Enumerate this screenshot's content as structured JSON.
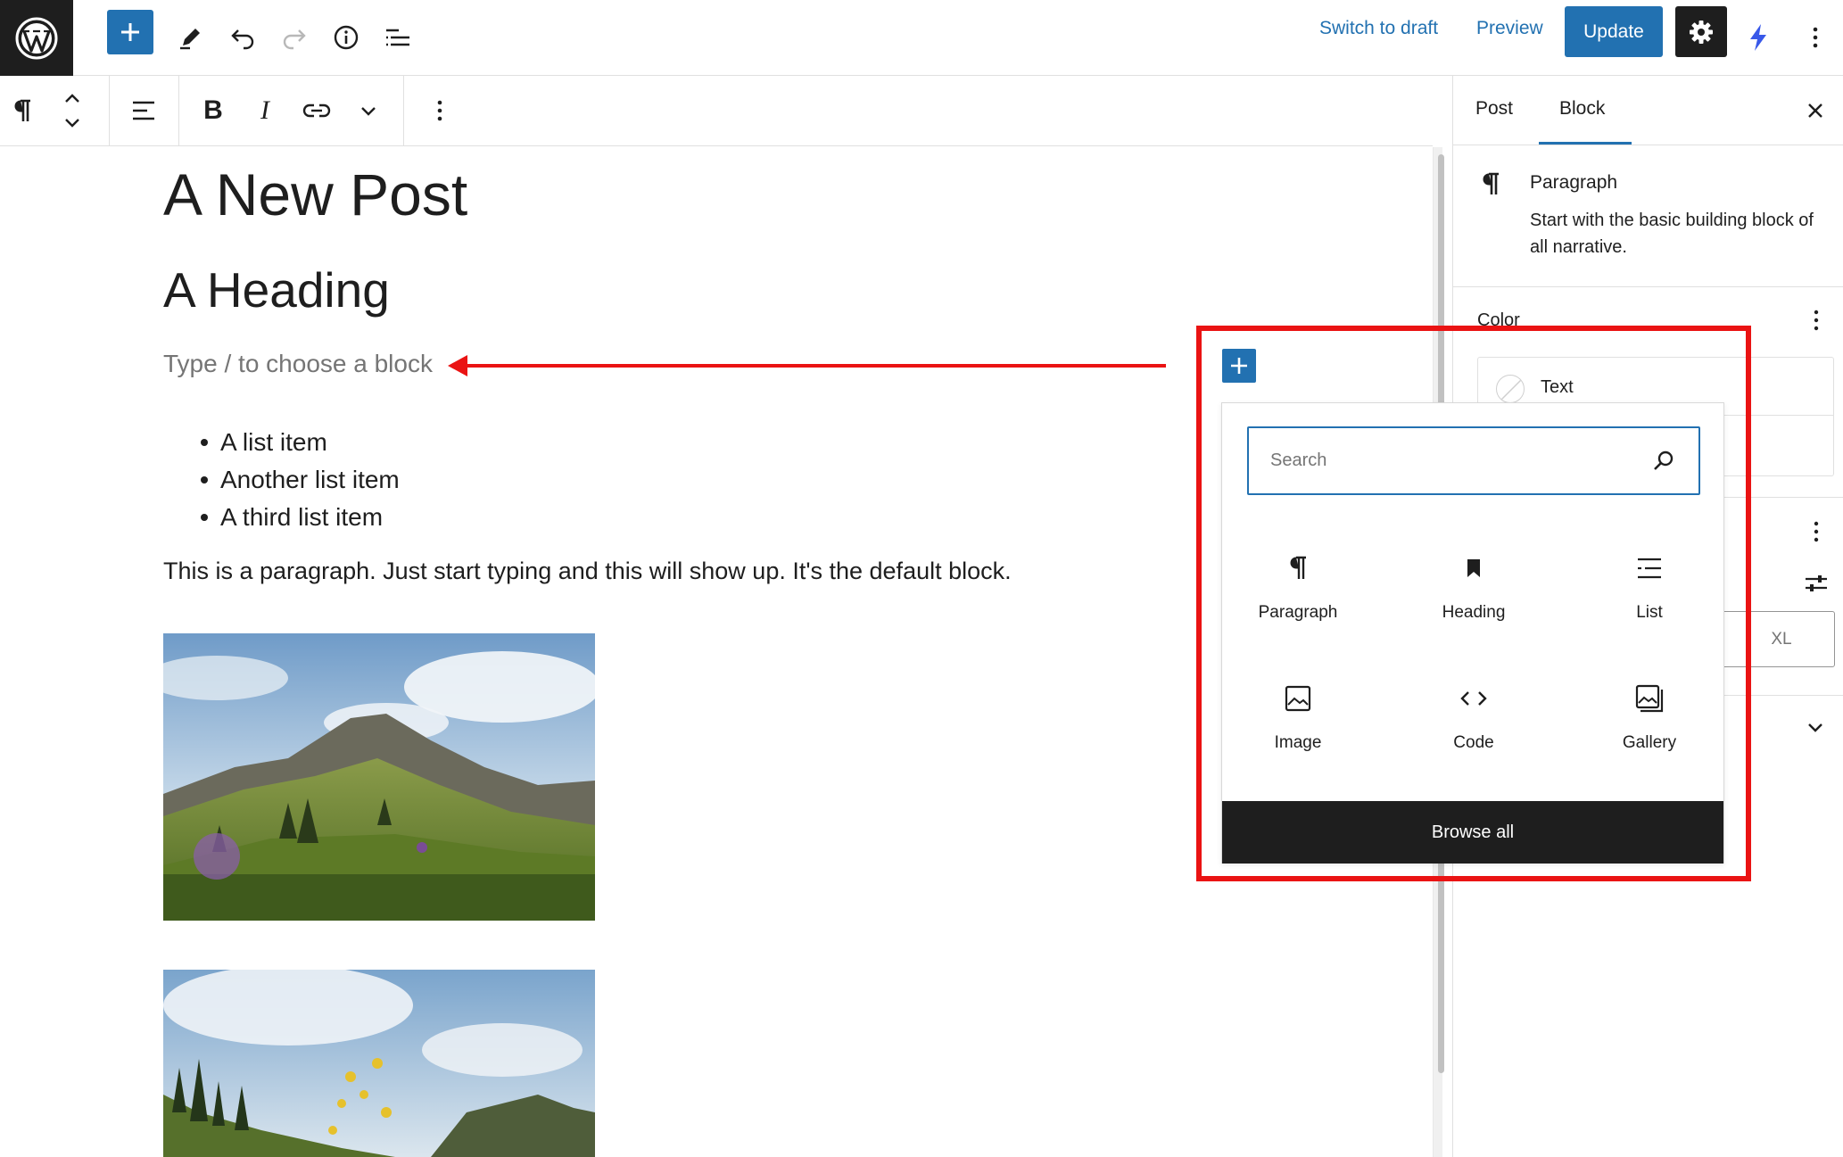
{
  "topbar": {
    "switch_to_draft": "Switch to draft",
    "preview": "Preview",
    "update": "Update",
    "icons": [
      "wordpress-logo",
      "plus-icon",
      "pencil-icon",
      "undo-icon",
      "redo-icon",
      "info-icon",
      "list-view-icon",
      "gear-icon",
      "lightning-icon",
      "more-vertical-icon"
    ]
  },
  "block_toolbar": {
    "icons": [
      "paragraph-icon",
      "move-up-down-icon",
      "align-icon",
      "bold-icon",
      "italic-icon",
      "link-icon",
      "chevron-down-icon",
      "more-vertical-icon"
    ],
    "bold": "B",
    "italic": "I"
  },
  "editor": {
    "post_title": "A New Post",
    "heading": "A Heading",
    "placeholder": "Type / to choose a block",
    "list_items": [
      "A list item",
      "Another list item",
      "A third list item"
    ],
    "paragraph": "This is a paragraph. Just start typing and this will show up. It's the default block."
  },
  "sidebar": {
    "tabs": [
      "Post",
      "Block"
    ],
    "active_tab": "Block",
    "block_card": {
      "title": "Paragraph",
      "description": "Start with the basic building block of all narrative."
    },
    "color_label": "Color",
    "text_color_label": "Text",
    "size_value": "XL"
  },
  "inserter": {
    "search_placeholder": "Search",
    "blocks": [
      {
        "label": "Paragraph",
        "icon": "paragraph-icon"
      },
      {
        "label": "Heading",
        "icon": "bookmark-icon"
      },
      {
        "label": "List",
        "icon": "list-icon"
      },
      {
        "label": "Image",
        "icon": "image-icon"
      },
      {
        "label": "Code",
        "icon": "code-icon"
      },
      {
        "label": "Gallery",
        "icon": "gallery-icon"
      }
    ],
    "browse_all": "Browse all"
  },
  "colors": {
    "accent": "#2271b1",
    "dark": "#1e1e1e",
    "annotation_red": "#ea1313",
    "placeholder_gray": "#757575"
  }
}
